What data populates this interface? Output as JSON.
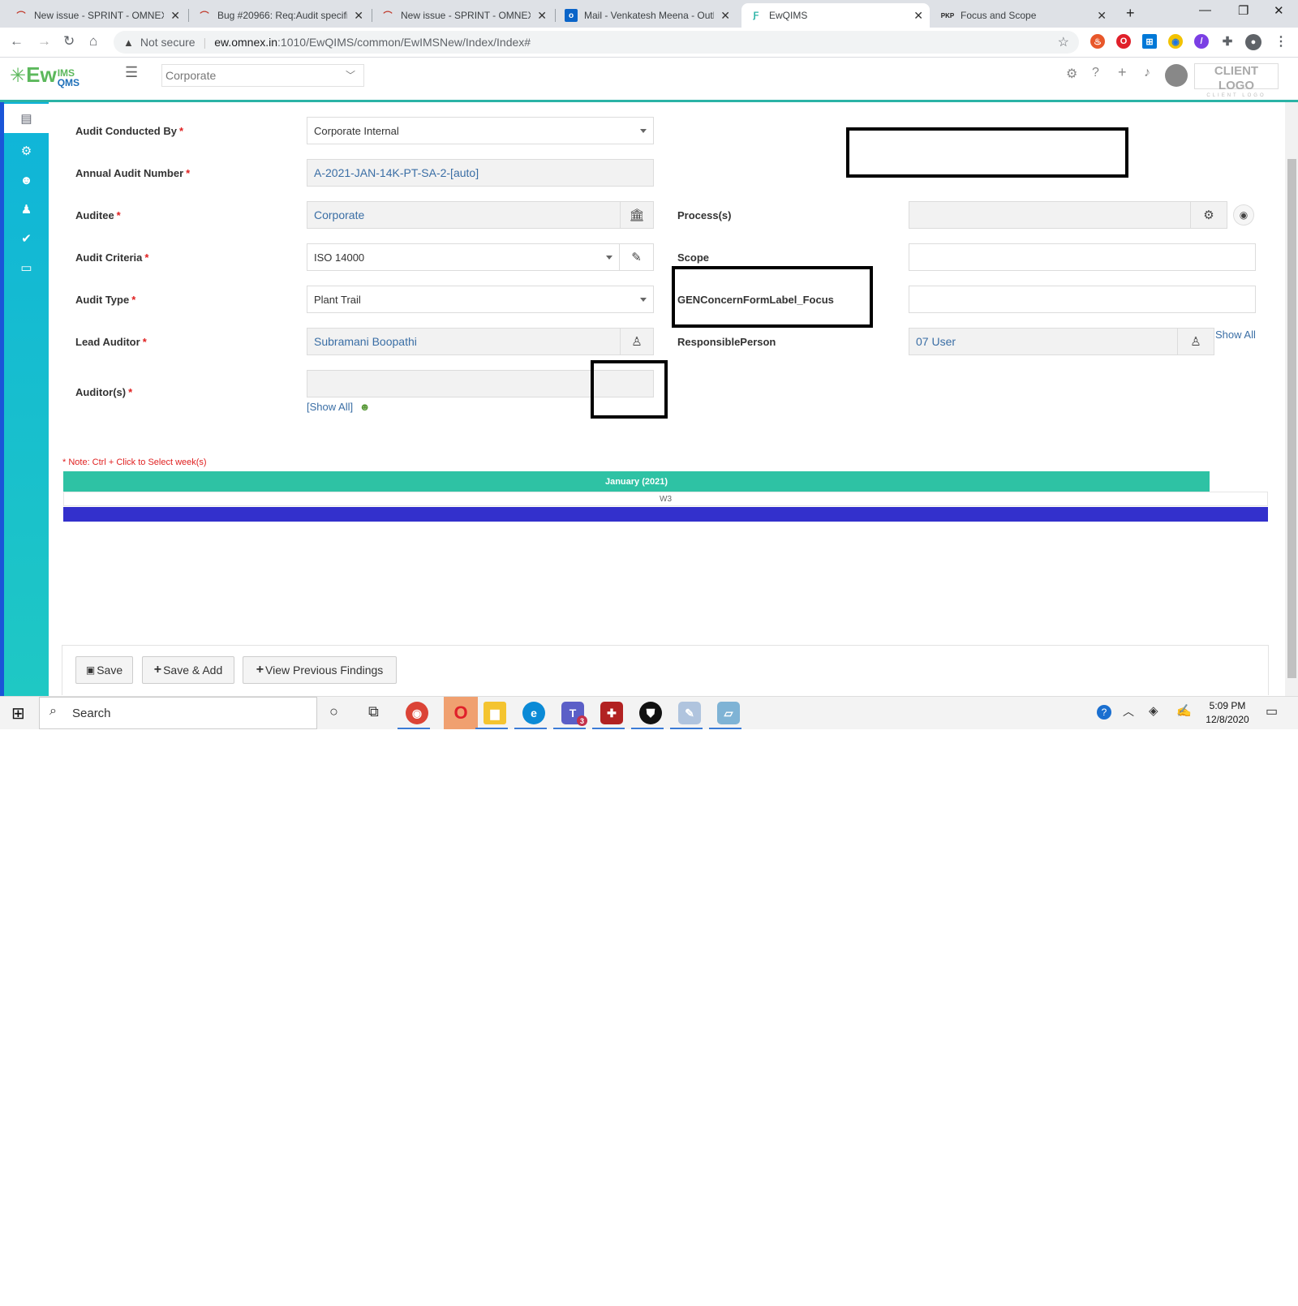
{
  "browser": {
    "tabs": [
      {
        "title": "New issue - SPRINT - OMNEX I",
        "icon": "redmine-icon"
      },
      {
        "title": "Bug #20966: Req:Audit specific",
        "icon": "redmine-icon"
      },
      {
        "title": "New issue - SPRINT - OMNEX I",
        "icon": "redmine-icon"
      },
      {
        "title": "Mail - Venkatesh Meena - Outl",
        "icon": "outlook-icon"
      },
      {
        "title": "EwQIMS",
        "icon": "ewqims-icon"
      },
      {
        "title": "Focus and Scope",
        "icon": "pkp-icon"
      }
    ],
    "security_label": "Not secure",
    "url_host": "ew.omnex.in",
    "url_path": ":1010/EwQIMS/common/EwIMSNew/Index/Index#",
    "pkp_text": "PKP"
  },
  "app": {
    "logo_ew": "Ew",
    "logo_ims": "IMS",
    "logo_qms": "QMS",
    "entity_select": "Corporate",
    "client_logo": "CLIENT LOGO",
    "client_logo_sub": "CLIENT LOGO"
  },
  "form": {
    "audit_conducted_by": {
      "label": "Audit Conducted By",
      "value": "Corporate Internal"
    },
    "annual_audit_number": {
      "label": "Annual Audit Number",
      "value": "A-2021-JAN-14K-PT-SA-2-[auto]"
    },
    "auditee": {
      "label": "Auditee",
      "value": "Corporate"
    },
    "audit_criteria": {
      "label": "Audit Criteria",
      "value": "ISO 14000"
    },
    "audit_type": {
      "label": "Audit Type",
      "value": "Plant Trail"
    },
    "lead_auditor": {
      "label": "Lead Auditor",
      "value": "Subramani Boopathi"
    },
    "auditors": {
      "label": "Auditor(s)",
      "value": "",
      "show_all": "[Show All]"
    },
    "processes": {
      "label": "Process(s)",
      "value": ""
    },
    "scope": {
      "label": "Scope",
      "value": ""
    },
    "focus": {
      "label": "GENConcernFormLabel_Focus",
      "value": ""
    },
    "responsible_person": {
      "label": "ResponsiblePerson",
      "value": "07 User",
      "show_all": "Show All"
    },
    "required_mark": "*"
  },
  "calendar": {
    "note": "* Note: Ctrl + Click to Select week(s)",
    "month": "January (2021)",
    "week": "W3"
  },
  "buttons": {
    "save": "Save",
    "save_add": "Save & Add",
    "view_previous": "View Previous Findings"
  },
  "taskbar": {
    "search": "Search",
    "time": "5:09 PM",
    "date": "12/8/2020",
    "teams_badge": "3"
  },
  "colors": {
    "accent": "#2bb3a6",
    "sidebar": "#19bdd2",
    "month_bar": "#2ec2a4",
    "week_bar": "#3330cc",
    "required": "#e02020"
  }
}
